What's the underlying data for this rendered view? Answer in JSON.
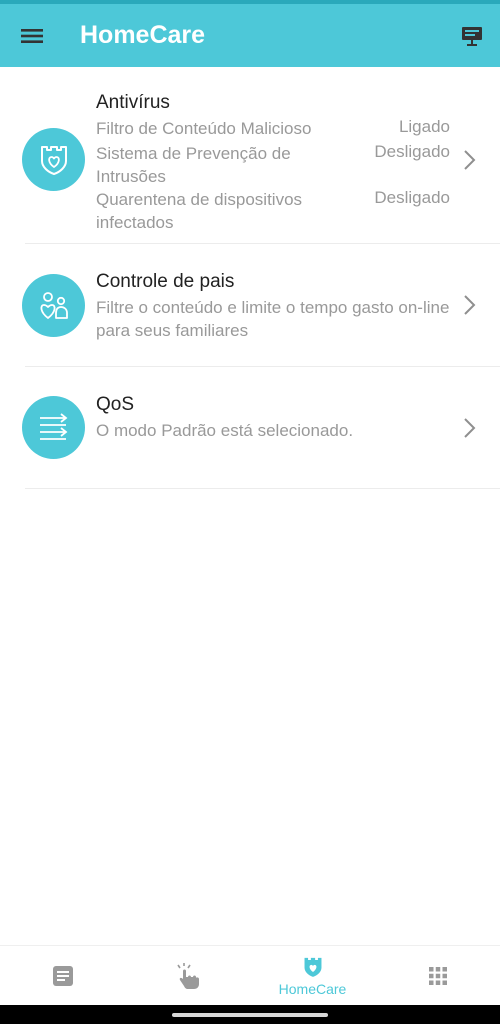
{
  "app_bar": {
    "title": "HomeCare",
    "menu_icon": "hamburger-menu-icon",
    "feedback_icon": "presentation-feedback-icon",
    "color": "#4dc8d8"
  },
  "cards": {
    "antivirus": {
      "title": "Antivírus",
      "icon": "shield-heart-icon",
      "rows": [
        {
          "label": "Filtro de Conteúdo Malicioso",
          "value": "Ligado"
        },
        {
          "label": "Sistema de Prevenção de Intrusões",
          "value": "Desligado"
        },
        {
          "label": "Quarentena de dispositivos infectados",
          "value": "Desligado"
        }
      ]
    },
    "parental": {
      "title": "Controle de pais",
      "icon": "family-heart-icon",
      "description": "Filtre o conteúdo e limite o tempo gasto on-line para seus familiares"
    },
    "qos": {
      "title": "QoS",
      "icon": "priority-arrows-icon",
      "description": "O modo Padrão está selecionado."
    }
  },
  "bottom_nav": {
    "items": [
      {
        "id": "overview",
        "icon": "document-icon",
        "label": ""
      },
      {
        "id": "tools",
        "icon": "tap-hand-icon",
        "label": ""
      },
      {
        "id": "homecare",
        "icon": "shield-heart-icon",
        "label": "HomeCare",
        "active": true
      },
      {
        "id": "more",
        "icon": "grid-icon",
        "label": ""
      }
    ],
    "active_color": "#4dc8d8",
    "inactive_color": "#9a9a9a"
  }
}
